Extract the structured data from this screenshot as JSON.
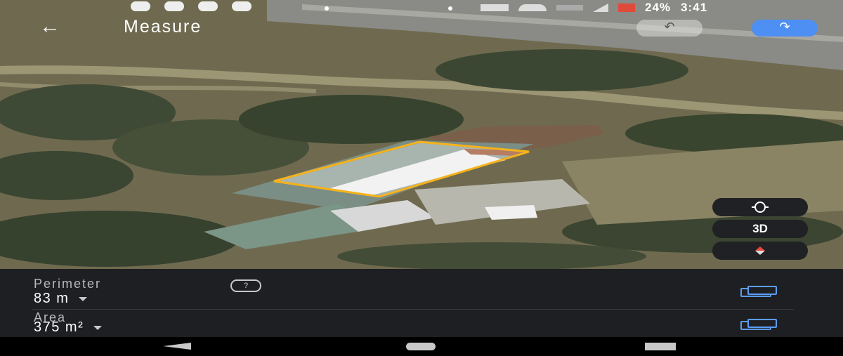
{
  "status_bar": {
    "battery": "24%",
    "time": "3:41",
    "icons": [
      "notification-icon",
      "cloud-icon",
      "cloud-icon",
      "cloud-icon",
      "wifi-icon",
      "signal-icon",
      "battery-icon"
    ]
  },
  "header": {
    "back_glyph": "←",
    "title": "Measure",
    "undo_glyph": "↶",
    "redo_glyph": "↷"
  },
  "map_controls": {
    "recenter_glyph": "⌖",
    "three_d_label": "3D",
    "compass_glyph": "◆"
  },
  "measurement": {
    "perimeter_label": "Perimeter",
    "perimeter_value": "83 m",
    "help_glyph": "?",
    "area_label": "Area",
    "area_value": "375 m²"
  },
  "colors": {
    "accent": "#4d8ff2",
    "polygon_outline": "#f6b21b",
    "panel_bg": "#1e1f22"
  }
}
